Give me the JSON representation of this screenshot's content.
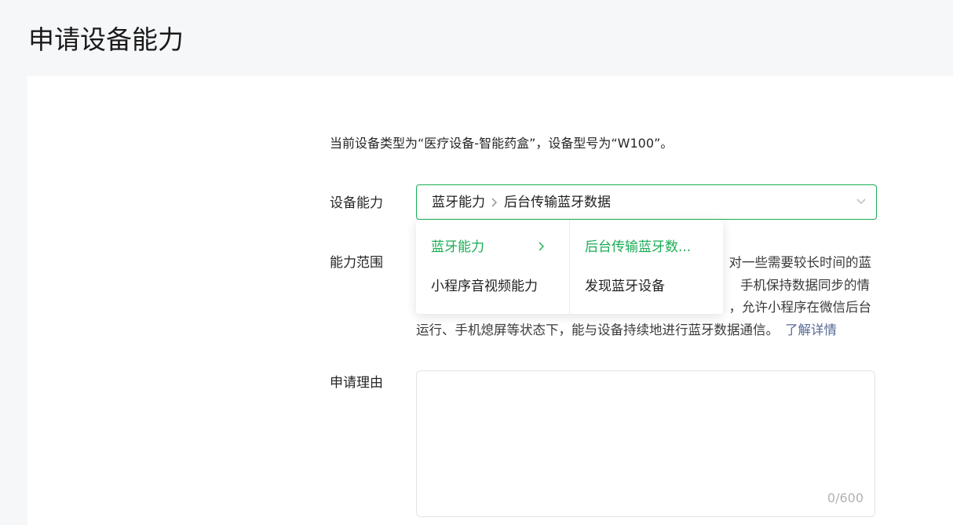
{
  "page": {
    "title": "申请设备能力"
  },
  "intro": "当前设备类型为“医疗设备-智能药盒”，设备型号为“W100”。",
  "capability": {
    "label": "设备能力",
    "selected": {
      "level1": "蓝牙能力",
      "level2": "后台传输蓝牙数据"
    },
    "dropdown": {
      "column1": [
        "蓝牙能力",
        "小程序音视频能力"
      ],
      "column2": [
        "后台传输蓝牙数...",
        "发现蓝牙设备"
      ]
    },
    "accent_color": "#1aad55"
  },
  "scope": {
    "label": "能力范围",
    "line1": "对一些需要较长时间的蓝",
    "line2": "手机保持数据同步的情",
    "line3": "，允许小程序在微信后台",
    "line4": "运行、手机熄屏等状态下，能与设备持续地进行蓝牙数据通信。",
    "link": "了解详情",
    "link_color": "#576b95"
  },
  "reason": {
    "label": "申请理由",
    "value": "",
    "counter": "0/600"
  },
  "icons": {
    "separator": "chevron-right-icon",
    "select_arrow": "chevron-down-icon",
    "submenu_arrow": "chevron-right-icon"
  }
}
